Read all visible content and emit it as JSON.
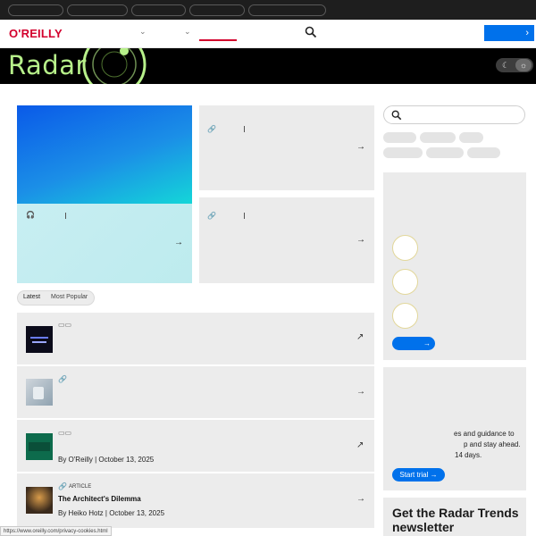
{
  "header": {
    "logo": "O'REILLY",
    "cta_label": "›"
  },
  "banner": {
    "title": "Radar",
    "moon_icon": "moon-icon",
    "sun_icon": "sun-icon"
  },
  "tabs": {
    "latest": "Latest",
    "popular": "Most Popular"
  },
  "list": [
    {
      "type_label": "",
      "title": "",
      "meta": ""
    },
    {
      "type_label": "",
      "title": "",
      "meta": ""
    },
    {
      "type_label": "",
      "title": "",
      "meta": "By O'Reilly | October 13, 2025"
    },
    {
      "type_label": "ARTICLE",
      "title": "The Architect's Dilemma",
      "meta": "By Heiko Hotz | October 13, 2025"
    }
  ],
  "sidebar": {
    "trial_line1": "es and guidance to",
    "trial_line2": "p and stay ahead.",
    "trial_line3": "14 days.",
    "trial_button": "Start trial →",
    "newsletter_title": "Get the Radar Trends newsletter"
  },
  "status_url": "https://www.oreilly.com/privacy-cookies.html",
  "colors": {
    "brand_red": "#d3002d",
    "accent_blue": "#0071eb",
    "banner_green": "#b7f08a"
  }
}
